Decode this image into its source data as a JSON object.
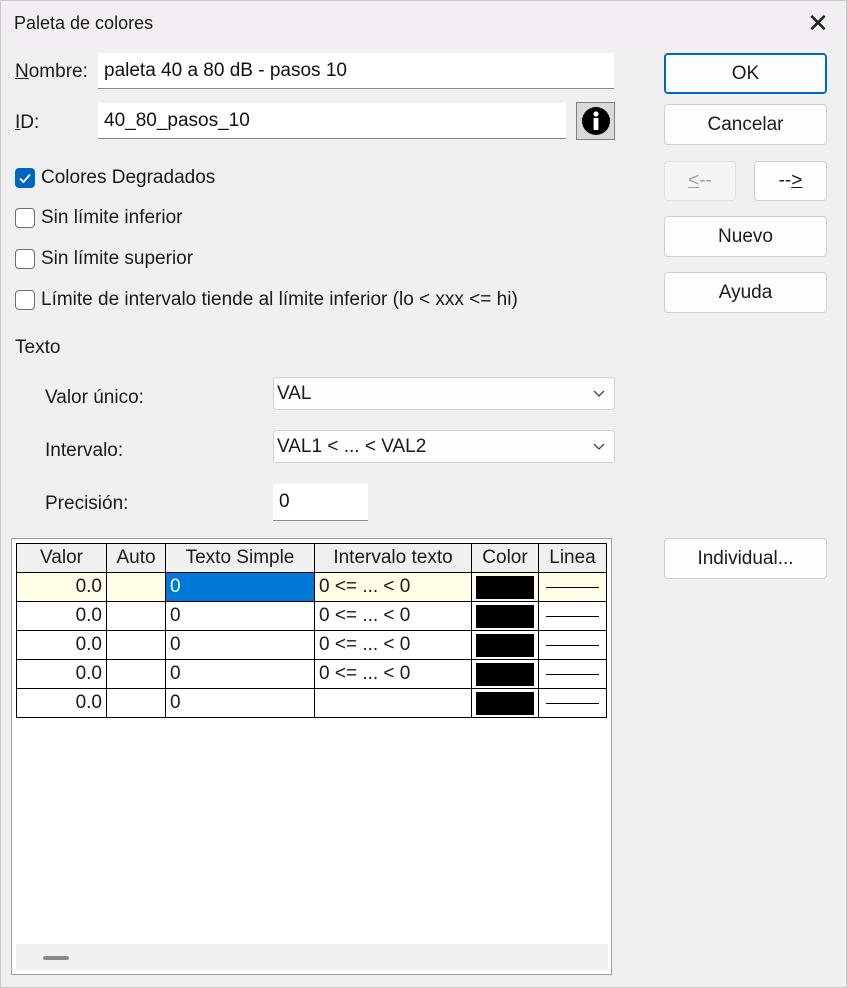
{
  "window": {
    "title": "Paleta de colores",
    "close": "✕"
  },
  "form": {
    "nombre_label_u": "N",
    "nombre_label_rest": "ombre:",
    "nombre_value": "paleta 40 a 80 dB - pasos 10",
    "id_label_u": "I",
    "id_label_rest": "D:",
    "id_value": "40_80_pasos_10"
  },
  "checkboxes": [
    {
      "label": "Colores Degradados",
      "checked": true
    },
    {
      "label": "Sin límite inferior",
      "checked": false
    },
    {
      "label": "Sin límite superior",
      "checked": false
    },
    {
      "label": "Límite de intervalo tiende al límite inferior (lo < xxx <= hi)",
      "checked": false
    }
  ],
  "texto": {
    "section_label": "Texto",
    "valor_unico_label": "Valor único:",
    "valor_unico_value": "VAL",
    "intervalo_label": "Intervalo:",
    "intervalo_value": "VAL1 < ... < VAL2",
    "precision_label": "Precisión:",
    "precision_value": "0"
  },
  "buttons": {
    "ok": "OK",
    "cancel": "Cancelar",
    "prev_u": "<",
    "prev_rest": "--",
    "next_rest": "--",
    "next_u": ">",
    "nuevo": "Nuevo",
    "ayuda": "Ayuda",
    "individual": "Individual..."
  },
  "grid": {
    "columns": [
      "Valor",
      "Auto",
      "Texto Simple",
      "Intervalo texto",
      "Color",
      "Linea"
    ],
    "rows": [
      {
        "valor": "0.0",
        "auto": "",
        "texto": "0",
        "intervalo": "0 <= ... < 0",
        "color": "#000000"
      },
      {
        "valor": "0.0",
        "auto": "",
        "texto": "0",
        "intervalo": "0 <= ... < 0",
        "color": "#000000"
      },
      {
        "valor": "0.0",
        "auto": "",
        "texto": "0",
        "intervalo": "0 <= ... < 0",
        "color": "#000000"
      },
      {
        "valor": "0.0",
        "auto": "",
        "texto": "0",
        "intervalo": "0 <= ... < 0",
        "color": "#000000"
      },
      {
        "valor": "0.0",
        "auto": "",
        "texto": "0",
        "intervalo": "",
        "color": "#000000"
      }
    ]
  },
  "icons": {
    "info": "info-icon",
    "checkmark": "checkmark-icon",
    "chevron": "chevron-down-icon"
  },
  "colors": {
    "accent": "#0067c0",
    "selection": "#0078d7",
    "row_highlight": "#fffde6"
  }
}
